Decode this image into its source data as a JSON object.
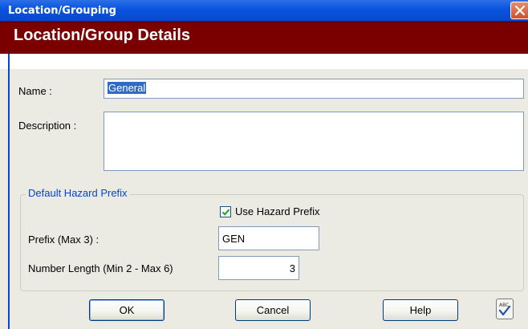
{
  "window": {
    "title": "Location/Grouping"
  },
  "header": {
    "title": "Location/Group Details"
  },
  "form": {
    "name_label": "Name :",
    "name_value": "General",
    "description_label": "Description :",
    "description_value": ""
  },
  "hazard_prefix": {
    "group_title": "Default Hazard Prefix",
    "use_prefix_label": "Use Hazard Prefix",
    "use_prefix_checked": true,
    "prefix_label": "Prefix (Max 3) :",
    "prefix_value": "GEN",
    "number_length_label": "Number Length (Min 2 - Max 6)",
    "number_length_value": "3"
  },
  "buttons": {
    "ok": "OK",
    "cancel": "Cancel",
    "help": "Help"
  },
  "icons": {
    "close": "close-icon",
    "spellcheck": "spellcheck-icon",
    "checkmark": "checkmark-icon"
  },
  "colors": {
    "titlebar": "#0b55e0",
    "header_band": "#7a0000",
    "panel": "#ebebe4",
    "group_title": "#0046d5"
  }
}
